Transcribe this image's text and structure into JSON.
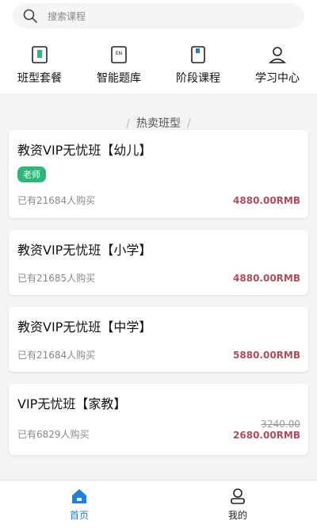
{
  "search": {
    "placeholder": "搜索课程"
  },
  "nav": [
    {
      "label": "班型套餐",
      "icon": "package-icon"
    },
    {
      "label": "智能题库",
      "icon": "question-bank-icon"
    },
    {
      "label": "阶段课程",
      "icon": "course-book-icon"
    },
    {
      "label": "学习中心",
      "icon": "user-center-icon"
    }
  ],
  "section": {
    "title": "热卖班型"
  },
  "courses": [
    {
      "title": "教资VIP无忧班【幼儿】",
      "tag": "老师",
      "buyers": "已有21684人购买",
      "price": "4880.00RMB"
    },
    {
      "title": "教资VIP无忧班【小学】",
      "buyers": "已有21685人购买",
      "price": "4880.00RMB"
    },
    {
      "title": "教资VIP无忧班【中学】",
      "buyers": "已有21684人购买",
      "price": "5880.00RMB"
    },
    {
      "title": "VIP无忧班【家教】",
      "buyers": "已有6829人购买",
      "original_price": "3240.00",
      "price": "2680.00RMB"
    }
  ],
  "tabbar": [
    {
      "label": "首页",
      "active": true
    },
    {
      "label": "我的",
      "active": false
    }
  ],
  "colors": {
    "accent": "#1e7fe0",
    "tag_green": "#2db77a",
    "price_red": "#b24c5c"
  }
}
